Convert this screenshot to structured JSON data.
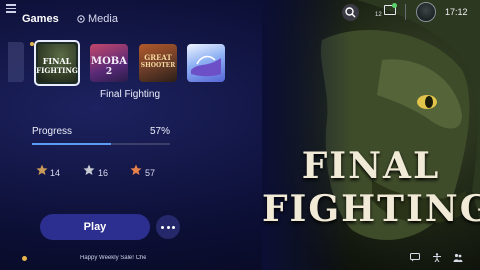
{
  "topbar": {
    "tabs": [
      {
        "label": "Games",
        "active": true
      },
      {
        "label": "Media",
        "active": false
      }
    ],
    "notification_count": "12",
    "clock": "17:12"
  },
  "library": {
    "tiles": [
      {
        "name": "Final Fighting",
        "art_text": [
          "FINAL",
          "FIGHTING"
        ],
        "selected": true
      },
      {
        "name": "MOBA 2",
        "art_text": [
          "MOBA",
          "2"
        ],
        "selected": false
      },
      {
        "name": "Great Shooter",
        "art_text": [
          "GREAT",
          "SHOOTER"
        ],
        "selected": false
      },
      {
        "name": "Fantasy game",
        "art_text": [],
        "selected": false
      }
    ],
    "selected_title": "Final Fighting"
  },
  "progress": {
    "label": "Progress",
    "percent_label": "57%",
    "value": 0.57
  },
  "trophies": [
    {
      "tier": "bronze",
      "count": "14",
      "color": "#c99a5a"
    },
    {
      "tier": "silver",
      "count": "16",
      "color": "#c9cbd4"
    },
    {
      "tier": "gold",
      "count": "57",
      "color": "#e8824a"
    }
  ],
  "actions": {
    "play_label": "Play"
  },
  "news": {
    "text": "Happy Weekly Sale! Check"
  },
  "hero": {
    "title_line1": "FINAL",
    "title_line2": "FIGHTING"
  },
  "icons": {
    "menu": "menu-icon",
    "media": "media-icon",
    "search": "search-icon",
    "notifications": "mail-icon",
    "avatar": "avatar",
    "bottom": [
      "chat-icon",
      "accessibility-icon",
      "friends-icon"
    ]
  },
  "colors": {
    "accent": "#5a9cf2",
    "play_button": "#2c2f8f",
    "indicator": "#e5b64b"
  }
}
